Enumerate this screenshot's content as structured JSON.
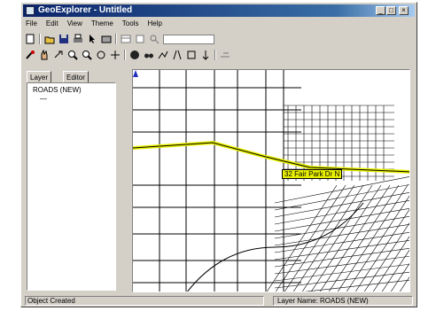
{
  "window": {
    "title": "GeoExplorer - Untitled",
    "controls": [
      "_",
      "□",
      "×"
    ]
  },
  "menu": [
    "File",
    "Edit",
    "View",
    "Theme",
    "Tools",
    "Help"
  ],
  "toolbar1_icons": [
    "new-icon",
    "open-icon",
    "save-icon",
    "print-icon",
    "pointer-icon",
    "select-icon",
    "table-icon",
    "layout-icon",
    "zoom-box-icon"
  ],
  "toolbar2_icons": [
    "identify-icon",
    "hand-icon",
    "find-icon",
    "zoom-in-icon",
    "zoom-out-icon",
    "pan-icon",
    "rotate-icon",
    "globe-icon",
    "binoculars-icon",
    "route-icon",
    "road-icon",
    "buffer-icon",
    "measure-icon",
    "query-icon"
  ],
  "tabs": {
    "layer": "Layer",
    "editor": "Editor"
  },
  "tree": {
    "root": "ROADS (NEW)",
    "child": "—"
  },
  "map": {
    "callout": "32 Fair Park Dr N",
    "highlight_color": "#e8f000",
    "line_color": "#000000"
  },
  "status": {
    "left": "Object Created",
    "right": "Layer Name: ROADS (NEW)"
  }
}
